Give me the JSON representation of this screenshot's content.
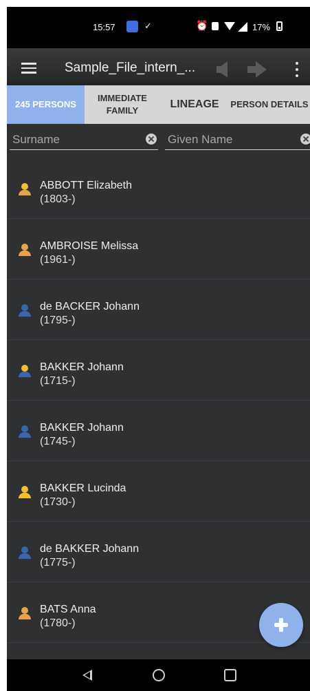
{
  "status_bar": {
    "time": "15:57",
    "check_glyph": "✓",
    "alarm_glyph": "⏰",
    "battery": "17%"
  },
  "app_bar": {
    "title": "Sample_File_intern_...",
    "menu_icon": "hamburger-menu-icon",
    "back_icon": "arrow-left-icon",
    "forward_icon": "arrow-right-icon",
    "overflow_icon": "more-vertical-icon"
  },
  "tabs": [
    {
      "label": "245 PERSONS",
      "active": true
    },
    {
      "label": "IMMEDIATE FAMILY",
      "active": false
    },
    {
      "label": "LINEAGE",
      "active": false
    },
    {
      "label": "PERSON DETAILS",
      "active": false
    }
  ],
  "filters": {
    "surname": {
      "placeholder": "Surname",
      "value": ""
    },
    "given_name": {
      "placeholder": "Given Name",
      "value": ""
    }
  },
  "persons": [
    {
      "name": "ABBOTT Elizabeth",
      "years": "(1803-)",
      "gender": "female"
    },
    {
      "name": "AMBROISE Melissa",
      "years": "(1961-)",
      "gender": "female"
    },
    {
      "name": "de BACKER Johann",
      "years": "(1795-)",
      "gender": "male"
    },
    {
      "name": "BAKKER Johann",
      "years": "(1715-)",
      "gender": "male"
    },
    {
      "name": "BAKKER Johann",
      "years": "(1745-)",
      "gender": "male"
    },
    {
      "name": "BAKKER Lucinda",
      "years": "(1730-)",
      "gender": "female"
    },
    {
      "name": "de BAKKER Johann",
      "years": "(1775-)",
      "gender": "male"
    },
    {
      "name": "BATS Anna",
      "years": "(1780-)",
      "gender": "female"
    }
  ],
  "colors": {
    "accent": "#8fb1ec",
    "female_icon": "#e8a24a",
    "female_head": "#f0c030",
    "male_icon": "#3d64b0",
    "male_head_alt": "#f0c030",
    "list_background": "#2f3032"
  },
  "fab": {
    "icon": "plus-icon"
  },
  "nav_bar": {
    "back": "nav-back-icon",
    "home": "nav-home-icon",
    "recents": "nav-recents-icon"
  }
}
